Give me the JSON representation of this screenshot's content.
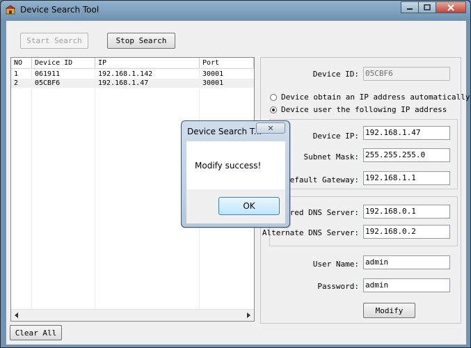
{
  "window": {
    "title": "Device Search Tool"
  },
  "toolbar": {
    "start_label": "Start Search",
    "stop_label": "Stop Search"
  },
  "list": {
    "columns": [
      "NO",
      "Device ID",
      "IP",
      "Port"
    ],
    "rows": [
      {
        "no": "1",
        "device_id": "061911",
        "ip": "192.168.1.142",
        "port": "30001"
      },
      {
        "no": "2",
        "device_id": "05CBF6",
        "ip": "192.168.1.47",
        "port": "30001"
      }
    ]
  },
  "clear_all_label": "Clear All",
  "form": {
    "device_id_label": "Device ID:",
    "device_id_value": "05CBF6",
    "radio_auto_label": "Device obtain an IP address automatically",
    "radio_manual_label": "Device user the following IP address",
    "device_ip_label": "Device IP:",
    "device_ip_value": "192.168.1.47",
    "subnet_label": "Subnet Mask:",
    "subnet_value": "255.255.255.0",
    "gateway_label": "Default Gateway:",
    "gateway_value": "192.168.1.1",
    "pref_dns_label": "erred DNS Server:",
    "pref_dns_value": "192.168.0.1",
    "alt_dns_label": "Alternate DNS Server:",
    "alt_dns_value": "192.168.0.2",
    "username_label": "User Name:",
    "username_value": "admin",
    "password_label": "Password:",
    "password_value": "admin",
    "modify_label": "Modify"
  },
  "dialog": {
    "title": "Device Search T...",
    "message": "Modify success!",
    "ok_label": "OK",
    "close_glyph": "✕"
  },
  "icons": {
    "minimize": "minimize-icon",
    "maximize": "maximize-icon",
    "close": "close-icon"
  }
}
